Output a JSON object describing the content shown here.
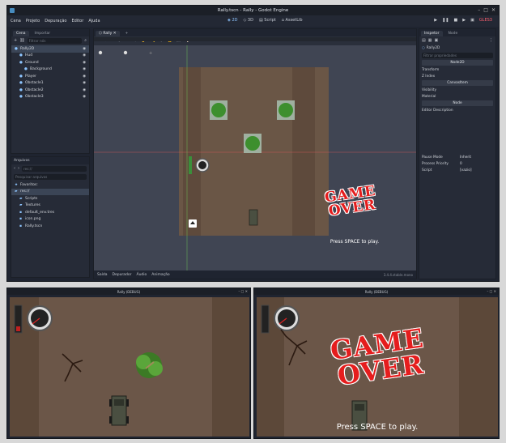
{
  "editor": {
    "title": "Rally.tscn - Rally - Godot Engine",
    "menu": [
      "Cena",
      "Projeto",
      "Depuração",
      "Editor",
      "Ajuda"
    ],
    "modes": [
      {
        "label": "2D",
        "active": true
      },
      {
        "label": "3D",
        "active": false
      },
      {
        "label": "Script",
        "active": false
      },
      {
        "label": "AssetLib",
        "active": false
      }
    ],
    "renderer": "GLES3",
    "scene_panel": {
      "tabs": [
        "Cena",
        "Importar"
      ],
      "filter_placeholder": "Filtrar nós",
      "nodes": [
        {
          "label": "Rally2D",
          "icon": "node2d-icon",
          "depth": 0,
          "selected": true
        },
        {
          "label": "Hud",
          "icon": "canvaslayer-icon",
          "depth": 1
        },
        {
          "label": "Ground",
          "icon": "node2d-icon",
          "depth": 1
        },
        {
          "label": "Background",
          "icon": "sprite-icon",
          "depth": 2
        },
        {
          "label": "Player",
          "icon": "kinematicbody-icon",
          "depth": 1
        },
        {
          "label": "Obstacle1",
          "icon": "staticbody-icon",
          "depth": 1
        },
        {
          "label": "Obstacle2",
          "icon": "staticbody-icon",
          "depth": 1
        },
        {
          "label": "Obstacle3",
          "icon": "staticbody-icon",
          "depth": 1
        }
      ]
    },
    "files_panel": {
      "title": "Arquivos",
      "path": "res://",
      "search_placeholder": "Pesquisar arquivos",
      "items": [
        {
          "label": "Favoritos:",
          "icon": "star-icon",
          "depth": 0
        },
        {
          "label": "res://",
          "icon": "folder-icon",
          "depth": 0,
          "selected": true
        },
        {
          "label": "Scripts",
          "icon": "folder-icon",
          "depth": 1
        },
        {
          "label": "Textures",
          "icon": "folder-icon",
          "depth": 1
        },
        {
          "label": "default_env.tres",
          "icon": "environment-icon",
          "depth": 1
        },
        {
          "label": "icon.png",
          "icon": "image-icon",
          "depth": 1
        },
        {
          "label": "Rally.tscn",
          "icon": "scene-icon",
          "depth": 1
        }
      ]
    },
    "viewport": {
      "tab": "Rally",
      "view_label": "Visualizar",
      "zoom": "",
      "bottom_tabs": [
        "Saída",
        "Depurador",
        "Áudio",
        "Animação"
      ],
      "version": "3.4.4.stable.mono",
      "gameover_line1": "GAME",
      "gameover_line2": "OVER",
      "press_text": "Press SPACE to play."
    },
    "inspector": {
      "tabs": [
        "Inspetor",
        "Node"
      ],
      "node_name": "Rally2D",
      "filter_placeholder": "Filtrar propriedades",
      "sections": [
        {
          "type": "head",
          "label": "Node2D"
        },
        {
          "type": "row",
          "label": "Transform"
        },
        {
          "type": "row",
          "label": "Z Index"
        },
        {
          "type": "head",
          "label": "CanvasItem"
        },
        {
          "type": "row",
          "label": "Visibility"
        },
        {
          "type": "row",
          "label": "Material"
        },
        {
          "type": "head",
          "label": "Node"
        },
        {
          "type": "row",
          "label": "Editor Description"
        }
      ],
      "props": [
        {
          "label": "Pause Mode",
          "value": "Inherit"
        },
        {
          "label": "Process Priority",
          "value": "0"
        },
        {
          "label": "Script",
          "value": "[vazio]"
        }
      ]
    }
  },
  "game_windows": [
    {
      "title": "Rally (DEBUG)",
      "show_gameover": false
    },
    {
      "title": "Rally (DEBUG)",
      "show_gameover": true,
      "gameover_line1": "GAME",
      "gameover_line2": "OVER",
      "press_text": "Press SPACE to play."
    }
  ],
  "colors": {
    "accent": "#478cbf",
    "gameover": "#e51d1d",
    "renderer": "#ff5f6e"
  }
}
